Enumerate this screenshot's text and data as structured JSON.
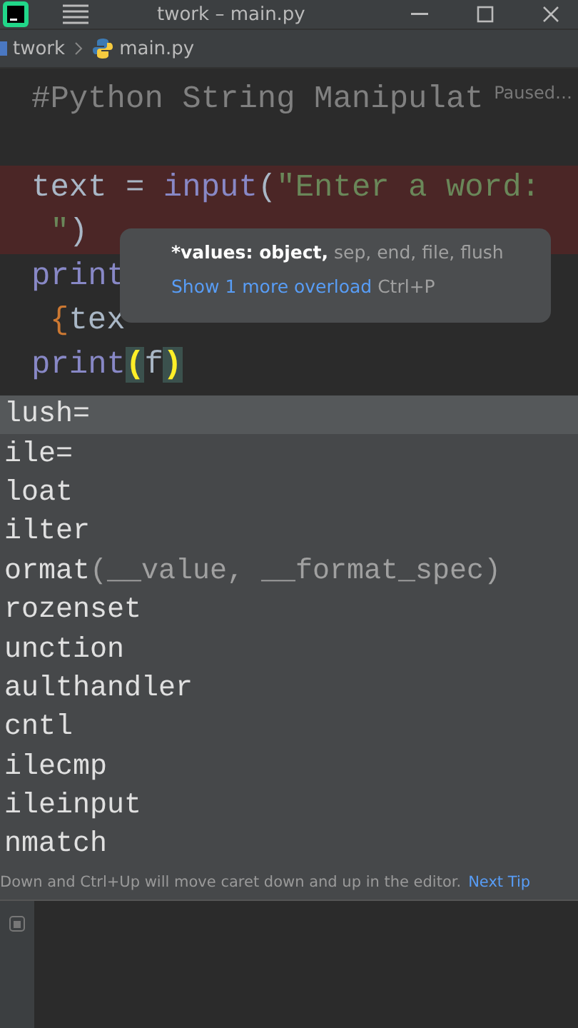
{
  "title_bar": {
    "title": "twork – main.py"
  },
  "breadcrumb": [
    {
      "label": "twork",
      "kind": "folder"
    },
    {
      "label": "main.py",
      "kind": "python"
    }
  ],
  "editor": {
    "status": "Paused…",
    "lines": [
      {
        "highlighted": false,
        "tokens": [
          {
            "kind": "comment",
            "text": "#Python String Manipulat"
          }
        ]
      },
      {
        "highlighted": false
      },
      {
        "highlighted": true,
        "tokens": [
          {
            "kind": "plain",
            "text": "text = "
          },
          {
            "kind": "builtin",
            "text": "input"
          },
          {
            "kind": "plain",
            "text": "("
          },
          {
            "kind": "string",
            "text": "\"Enter a word:"
          }
        ]
      },
      {
        "highlighted": true,
        "tokens": [
          {
            "kind": "string",
            "text": " \""
          },
          {
            "kind": "plain",
            "text": ")"
          }
        ]
      },
      {
        "highlighted": false,
        "tokens": [
          {
            "kind": "builtin",
            "text": "print"
          }
        ]
      },
      {
        "highlighted": false,
        "indent": true,
        "tokens": [
          {
            "kind": "brace",
            "text": "{"
          },
          {
            "kind": "plain",
            "text": "tex"
          }
        ]
      },
      {
        "highlighted": false,
        "tokens": [
          {
            "kind": "builtin",
            "text": "print"
          },
          {
            "kind": "matched",
            "text": "("
          },
          {
            "kind": "plain",
            "text": "f"
          },
          {
            "kind": "matched",
            "text": ")"
          }
        ]
      }
    ]
  },
  "parameter_info": {
    "current": "*values: object,",
    "rest": "sep, end, file, flush",
    "link": "Show 1 more overload",
    "shortcut": "Ctrl+P"
  },
  "completion": {
    "items": [
      {
        "label": "lush=",
        "selected": true
      },
      {
        "label": "ile=",
        "selected": false
      },
      {
        "label": "loat",
        "selected": false
      },
      {
        "label": "ilter",
        "selected": false
      },
      {
        "label": "ormat",
        "tail": "(__value, __format_spec)",
        "selected": false
      },
      {
        "label": "rozenset",
        "selected": false
      },
      {
        "label": "unction",
        "selected": false
      },
      {
        "label": "aulthandler",
        "selected": false
      },
      {
        "label": "cntl",
        "selected": false
      },
      {
        "label": "ilecmp",
        "selected": false
      },
      {
        "label": "ileinput",
        "selected": false
      },
      {
        "label": "nmatch",
        "selected": false
      }
    ],
    "tip": "Down and Ctrl+Up will move caret down and up in the editor.",
    "tip_link": "Next Tip"
  }
}
